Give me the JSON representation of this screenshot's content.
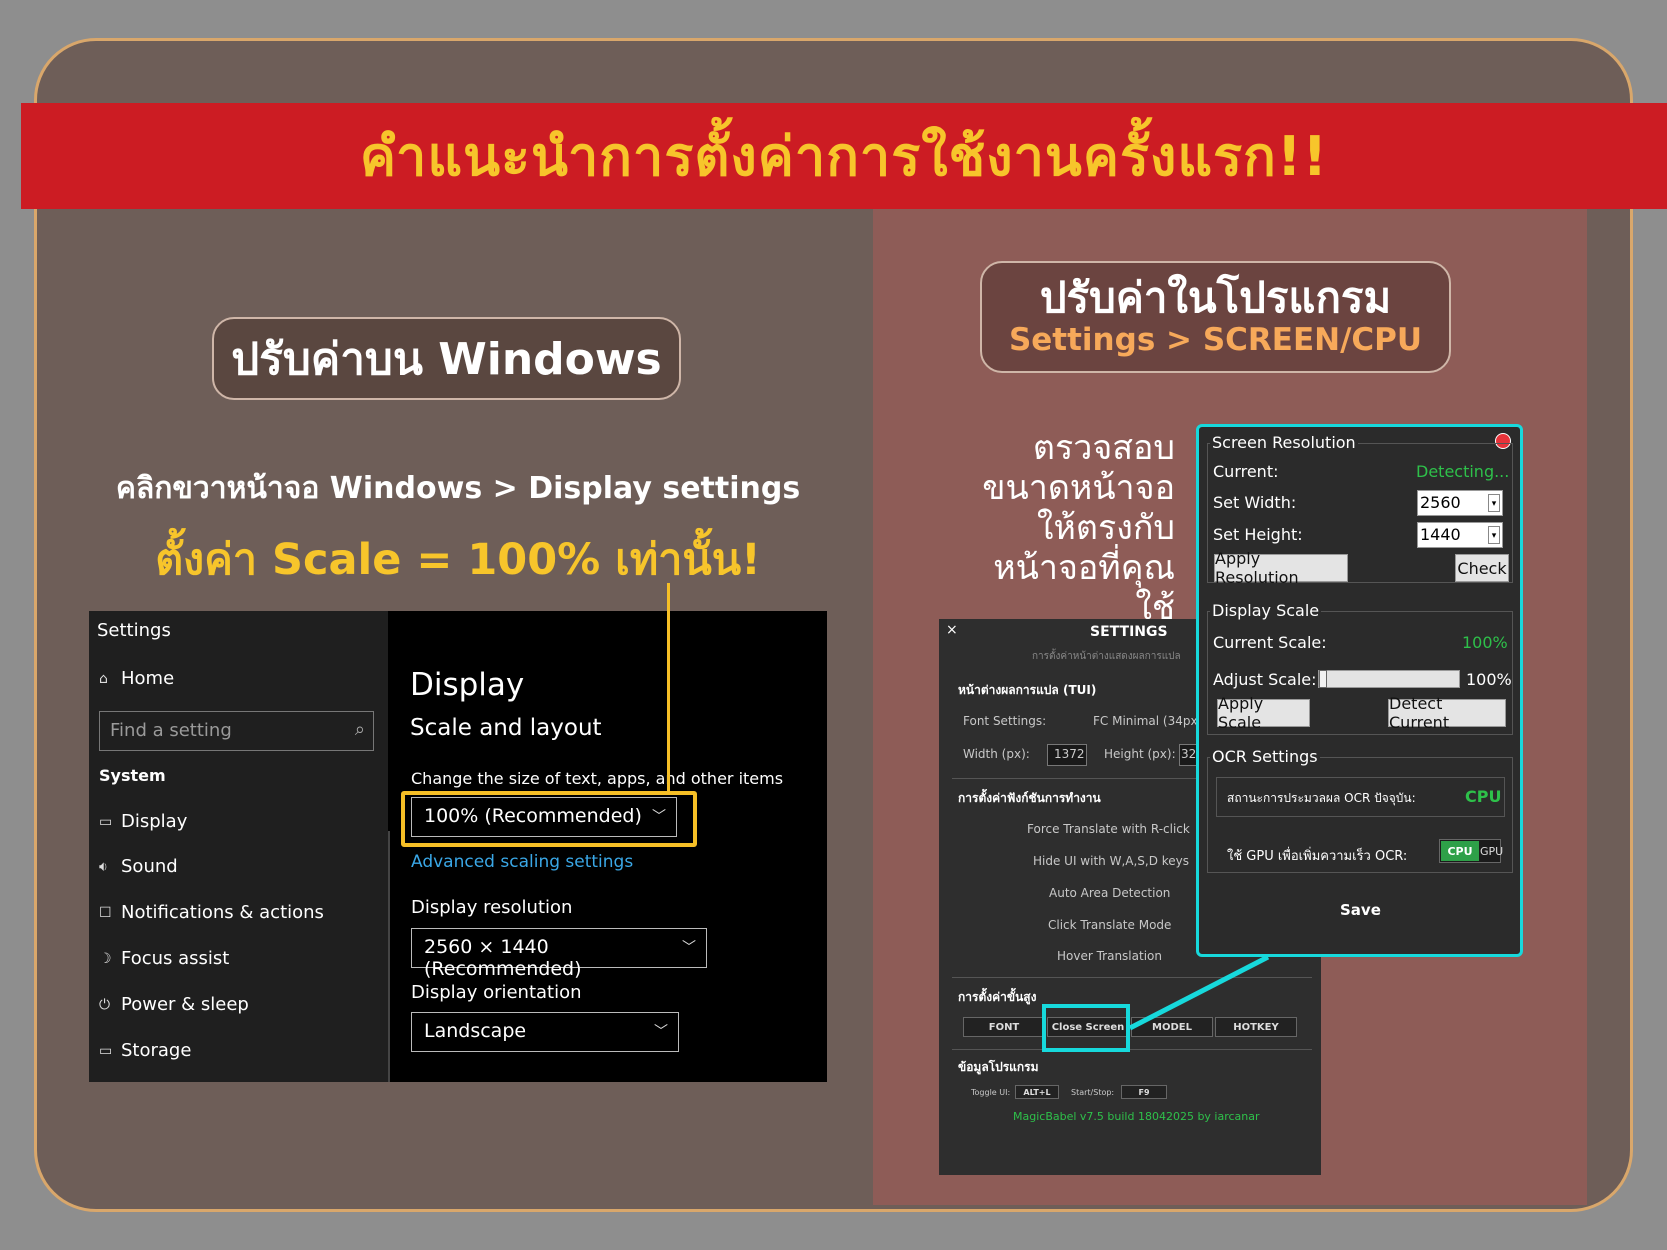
{
  "banner": {
    "title": "คำแนะนำการตั้งค่าการใช้งานครั้งแรก!!"
  },
  "left_panel": {
    "pill": "ปรับค่าบน Windows",
    "instruction": "คลิกขวาหน้าจอ Windows > Display settings",
    "scale_note": "ตั้งค่า Scale = 100% เท่านั้น!"
  },
  "right_panel": {
    "pill_title": "ปรับค่าในโปรแกรม",
    "pill_sub": "Settings > SCREEN/CPU",
    "check_lines": [
      "ตรวจสอบ",
      "ขนาดหน้าจอ",
      "ให้ตรงกับ",
      "หน้าจอที่คุณใช้"
    ]
  },
  "win_settings": {
    "title": "Settings",
    "home": "Home",
    "search_placeholder": "Find a setting",
    "section": "System",
    "nav": [
      "Display",
      "Sound",
      "Notifications & actions",
      "Focus assist",
      "Power & sleep",
      "Storage"
    ],
    "page_title": "Display",
    "subtitle": "Scale and layout",
    "scale_label": "Change the size of text, apps, and other items",
    "scale_value": "100% (Recommended)",
    "advanced_link": "Advanced scaling settings",
    "resolution_label": "Display resolution",
    "resolution_value": "2560 × 1440 (Recommended)",
    "orientation_label": "Display orientation",
    "orientation_value": "Landscape"
  },
  "prog_settings": {
    "close": "×",
    "title": "SETTINGS",
    "subtitle": "การตั้งค่าหน้าต่างแสดงผลการแปล",
    "tui_header": "หน้าต่างผลการแปล (TUI)",
    "font_label": "Font Settings:",
    "font_value": "FC Minimal (34px",
    "width_label": "Width (px):",
    "width_value": "1372",
    "height_label": "Height (px):",
    "height_value": "32",
    "func_header": "การตั้งค่าฟังก์ชันการทำงาน",
    "functions": [
      "Force Translate with R-click",
      "Hide UI with W,A,S,D keys",
      "Auto Area Detection",
      "Click Translate Mode",
      "Hover Translation"
    ],
    "adv_header": "การตั้งค่าขั้นสูง",
    "adv_buttons": [
      "FONT",
      "Close Screen",
      "MODEL",
      "HOTKEY"
    ],
    "info_header": "ข้อมูลโปรแกรม",
    "toggle_label": "Toggle UI:",
    "toggle_value": "ALT+L",
    "start_label": "Start/Stop:",
    "start_value": "F9",
    "version": "MagicBabel v7.5 build 18042025 by iarcanar"
  },
  "popup": {
    "res_group": "Screen Resolution",
    "current_label": "Current:",
    "current_value": "Detecting...",
    "width_label": "Set Width:",
    "width_value": "2560",
    "height_label": "Set Height:",
    "height_value": "1440",
    "apply_res": "Apply Resolution",
    "check": "Check",
    "scale_group": "Display Scale",
    "current_scale_label": "Current Scale:",
    "current_scale_value": "100%",
    "adjust_label": "Adjust Scale:",
    "adjust_value": "100%",
    "adjust_level": 0.0,
    "apply_scale": "Apply Scale",
    "detect": "Detect Current",
    "ocr_group": "OCR Settings",
    "ocr_status_label": "สถานะการประมวลผล OCR ปัจจุบัน:",
    "ocr_status_value": "CPU",
    "gpu_label": "ใช้ GPU เพื่อเพิ่มความเร็ว OCR:",
    "toggle_cpu": "CPU",
    "toggle_gpu": "GPU",
    "save": "Save"
  },
  "colors": {
    "banner_red": "#cc1c23",
    "accent_yellow": "#f7c52b",
    "highlight_cyan": "#17d9dc",
    "status_green": "#2ec04a"
  }
}
